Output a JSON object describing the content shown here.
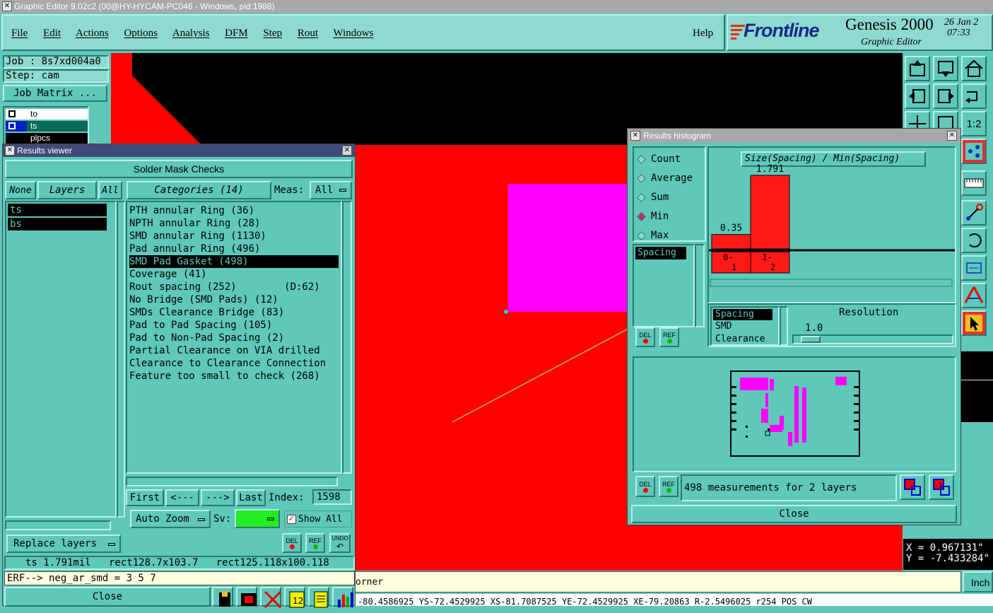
{
  "window_title": "Graphic Editor 9.02c2 (00@HY-HYCAM-PC046 - Windows, pid:1988)",
  "menu": [
    "File",
    "Edit",
    "Actions",
    "Options",
    "Analysis",
    "DFM",
    "Step",
    "Rout",
    "Windows"
  ],
  "help": "Help",
  "brand": {
    "logo": "Frontline",
    "product": "Genesis 2000",
    "subtitle": "Graphic Editor",
    "date": "26 Jan 2",
    "time": "07:33"
  },
  "job": {
    "job": "Job : 8s7xd004a0",
    "step": "Step: cam",
    "matrix": "Job Matrix ..."
  },
  "layers_mini": [
    "to",
    "ts",
    "plpcs"
  ],
  "results_viewer": {
    "title": "Results viewer",
    "header": "Solder Mask Checks",
    "none": "None",
    "layers": "Layers",
    "all": "All",
    "categories_label": "Categories (14)",
    "meas_label": "Meas:",
    "meas_value": "All",
    "layer_list": [
      "ts",
      "bs"
    ],
    "categories": [
      "PTH annular Ring (36)",
      "NPTH annular Ring (28)",
      "SMD annular Ring (1130)",
      "Pad annular Ring (496)",
      "SMD Pad Gasket (498)",
      "Coverage (41)",
      "Rout spacing (252)        (D:62)",
      "No Bridge (SMD Pads) (12)",
      "SMDs Clearance Bridge (83)",
      "Pad to Pad Spacing (105)",
      "Pad to Non-Pad Spacing (2)",
      "Partial Clearance on VIA drilled",
      "Clearance to Clearance Connection",
      "Feature too small to check (268)"
    ],
    "selected_index": 4,
    "first": "First",
    "prev": "<---",
    "next": "--->",
    "last": "Last",
    "index_label": "Index:",
    "index_value": "1598",
    "auto_zoom": "Auto Zoom",
    "sv_label": "Sv:",
    "show_all": "Show All",
    "replace_layers": "Replace layers",
    "del": "DEL",
    "ref": "REF",
    "undo": "UNDO",
    "status": "ts 1.791mil   rect128.7x103.7   rect125.118x100.118",
    "erf": "ERF--> neg_ar_smd = 3 5 7",
    "close": "Close"
  },
  "histogram": {
    "title": "Results histogram",
    "modes": [
      "Count",
      "Average",
      "Sum",
      "Min",
      "Max"
    ],
    "selected_mode": "Min",
    "measure_list": [
      "Spacing"
    ],
    "chart_title": "Size(Spacing) / Min(Spacing)",
    "resolution_label": "Resolution",
    "resolution_value": "1.0",
    "attr_list": [
      "Spacing",
      "SMD",
      "Clearance"
    ],
    "summary": "498 measurements for 2 layers",
    "close": "Close",
    "del": "DEL",
    "ref": "REF"
  },
  "chart_data": {
    "type": "bar",
    "title": "Size(Spacing) / Min(Spacing)",
    "categories": [
      "0-1",
      "1-2"
    ],
    "values": [
      0.35,
      1.791
    ],
    "colors": [
      "#ff1a1a",
      "#ff1a1a"
    ]
  },
  "coords": {
    "x": "X = 0.967131\"",
    "y": "Y = -7.433284\""
  },
  "bottom": {
    "corner": "orner",
    "units": "Inch",
    "coords_line": "-80.4586925 YS-72.4529925 XS-81.7087525 YE-72.4529925 XE-79.20863 R-2.5496025 r254 POS CW"
  }
}
